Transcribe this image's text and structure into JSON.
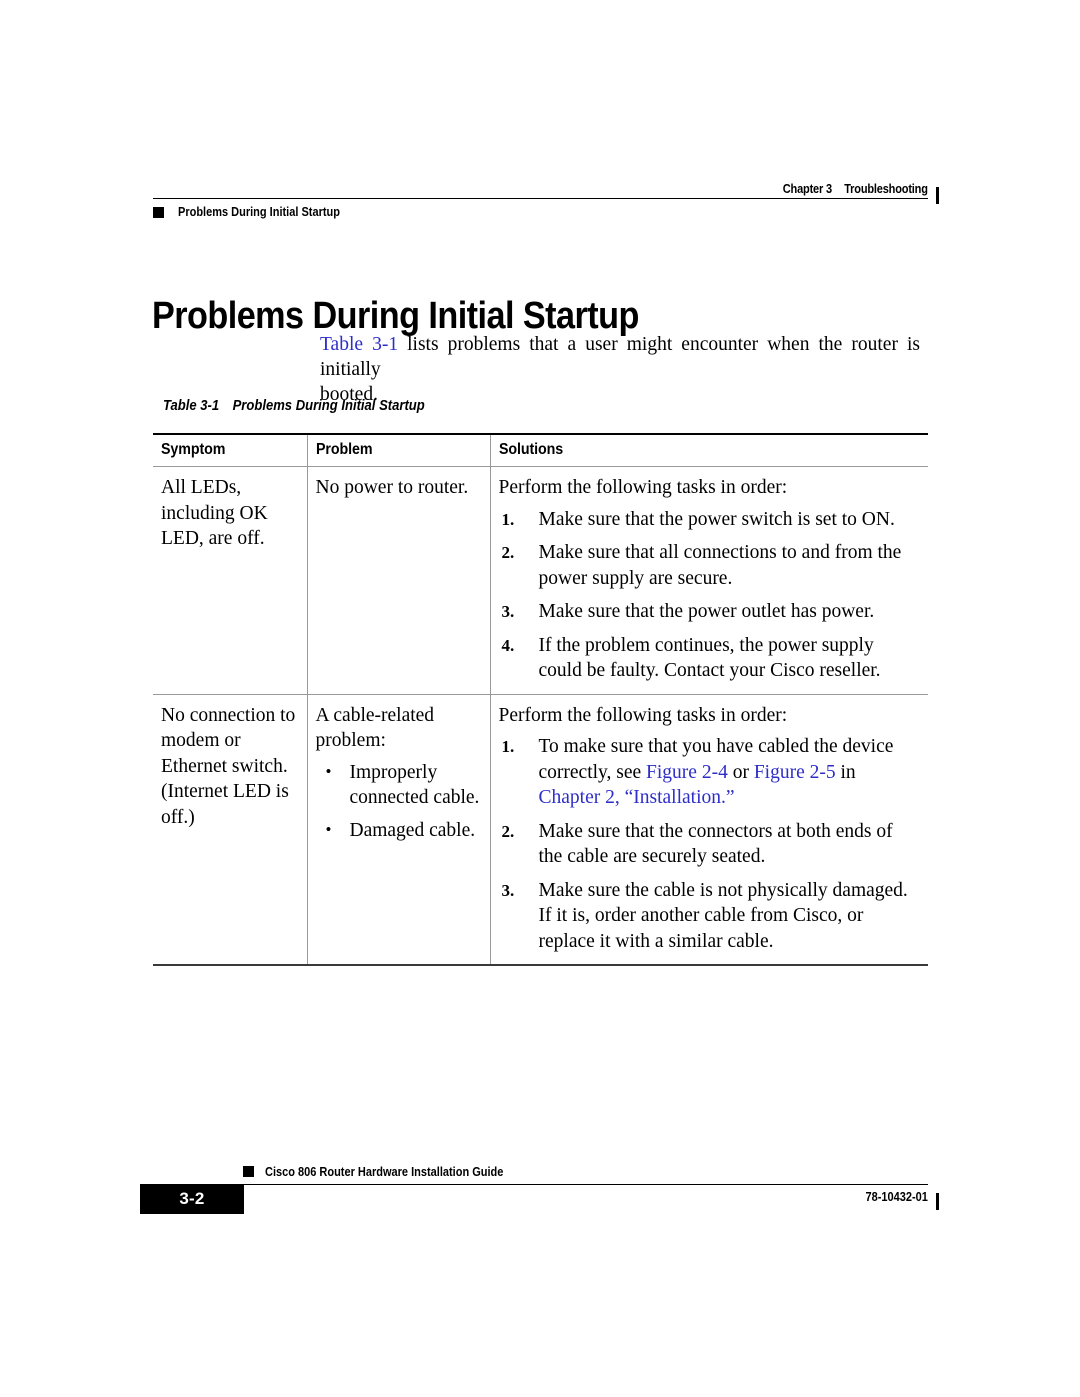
{
  "header": {
    "chapter_label": "Chapter 3",
    "chapter_title": "Troubleshooting",
    "section_title": "Problems During Initial Startup"
  },
  "heading": "Problems During Initial Startup",
  "intro": {
    "link_text": "Table 3-1",
    "body_text": " lists problems that a user might encounter when the router is initially",
    "second_line": "booted."
  },
  "table": {
    "caption_number": "Table 3-1",
    "caption_title": "Problems During Initial Startup",
    "columns": [
      "Symptom",
      "Problem",
      "Solutions"
    ],
    "rows": [
      {
        "symptom": "All LEDs, including OK LED, are off.",
        "problem_intro": "No power to router.",
        "problem_bullets": [],
        "solutions_intro": "Perform the following tasks in order:",
        "solutions_steps": [
          {
            "num": "1.",
            "text": "Make sure that the power switch is set to ON."
          },
          {
            "num": "2.",
            "text": "Make sure that all connections to and from the power supply are secure."
          },
          {
            "num": "3.",
            "text": "Make sure that the power outlet has power."
          },
          {
            "num": "4.",
            "text": "If the problem continues, the power supply could be faulty. Contact your Cisco reseller."
          }
        ]
      },
      {
        "symptom": "No connection to modem or Ethernet switch. (Internet LED is off.)",
        "problem_intro": "A cable-related problem:",
        "problem_bullets": [
          "Improperly connected cable.",
          "Damaged cable."
        ],
        "solutions_intro": "Perform the following tasks in order:",
        "solutions_steps": [
          {
            "num": "1.",
            "text_part1": "To make sure that you have cabled the device correctly, see ",
            "link1": "Figure 2-4",
            "text_part2": " or ",
            "link2": "Figure 2-5",
            "text_part3": " in ",
            "link3": "Chapter 2, “Installation.”"
          },
          {
            "num": "2.",
            "text": "Make sure that the connectors at both ends of the cable are securely seated."
          },
          {
            "num": "3.",
            "text": "Make sure the cable is not physically damaged. If it is, order another cable from Cisco, or replace it with a similar cable."
          }
        ]
      }
    ]
  },
  "footer": {
    "guide_title": "Cisco 806 Router Hardware Installation Guide",
    "page_number": "3-2",
    "doc_number": "78-10432-01"
  },
  "colors": {
    "link": "#2d2dc8",
    "rule": "#000000",
    "table_rule": "#9a9a9a"
  }
}
